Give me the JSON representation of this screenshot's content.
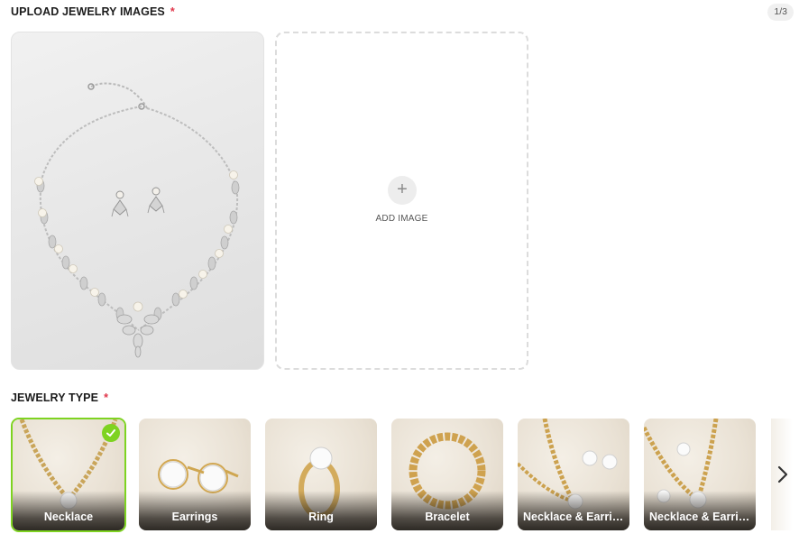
{
  "upload": {
    "label": "UPLOAD JEWELRY IMAGES",
    "required_mark": "*",
    "counter": "1/3",
    "add_image_label": "ADD IMAGE",
    "add_icon": "plus-icon"
  },
  "jewelry_type": {
    "label": "JEWELRY TYPE",
    "required_mark": "*",
    "selected": "Necklace",
    "options": [
      {
        "label": "Necklace"
      },
      {
        "label": "Earrings"
      },
      {
        "label": "Ring"
      },
      {
        "label": "Bracelet"
      },
      {
        "label": "Necklace & Earrings"
      },
      {
        "label": "Necklace & Earrings"
      }
    ],
    "next_icon": "chevron-right-icon"
  },
  "colors": {
    "required": "#e0364a",
    "selected_border": "#7ed321",
    "dashed_border": "#dcdcdc"
  }
}
